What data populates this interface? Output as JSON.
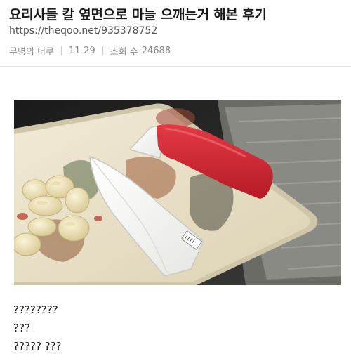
{
  "post": {
    "title": "요리사들 칼 옆면으로 마늘 으깨는거 해본 후기",
    "url": "https://theqoo.net/935378752",
    "author": "무명의 더쿠",
    "date": "11-29",
    "views_label": "조회 수",
    "views_count": "24688"
  },
  "photo": {
    "icon": "kitchen-photo"
  },
  "body": {
    "lines": [
      "????????",
      "???",
      "????? ???"
    ]
  },
  "colors": {
    "knife_handle": "#d42030",
    "board": "#e8dfc8",
    "garlic": "#efe3bc",
    "meta_text": "#8a8a8a"
  }
}
